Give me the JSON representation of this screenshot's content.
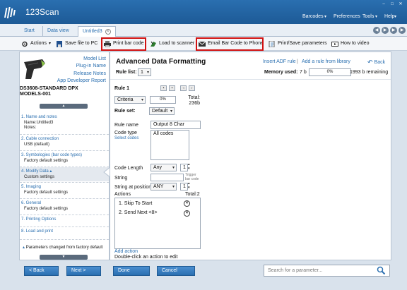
{
  "app": {
    "title": "123Scan"
  },
  "menu": [
    "Barcodes",
    "Preferences",
    "Tools",
    "Help"
  ],
  "tabs": [
    {
      "label": "Start"
    },
    {
      "label": "Data view"
    },
    {
      "label": "Untitled3"
    }
  ],
  "toolbar": {
    "actions": "Actions",
    "save_file": "Save file to PC",
    "print_barcode": "Print bar code",
    "load_scanner": "Load to scanner",
    "email_barcode": "Email Bar Code to Phone",
    "print_save": "Print/Save parameters",
    "how_to_video": "How to video"
  },
  "left": {
    "links": [
      "Model List",
      "Plug-in Name",
      "Release Notes",
      "App Developer Report"
    ],
    "model_line1": "DS3608-STANDARD DPX",
    "model_line2": "MODELS-001",
    "steps": [
      {
        "title": "1. Name and notes",
        "sub1": "Name:Untitled3",
        "sub2": "Notes:"
      },
      {
        "title": "2. Cable connection",
        "sub1": "USB (default)"
      },
      {
        "title": "3. Symbologies (bar code types)",
        "sub1": "Factory default settings"
      },
      {
        "title": "4. Modify Data",
        "sub1": "Custom settings"
      },
      {
        "title": "5. Imaging",
        "sub1": "Factory default settings"
      },
      {
        "title": "6. General",
        "sub1": "Factory default settings"
      },
      {
        "title": "7. Printing Options"
      },
      {
        "title": "8. Load and print"
      }
    ],
    "footnote": "Parameters changed from factory default"
  },
  "main": {
    "title": "Advanced Data Formatting",
    "insert_adf": "Insert ADF rule",
    "add_rule": "Add a rule from library",
    "back": "Back",
    "rule_list_label": "Rule list:",
    "rule_list_value": "1",
    "memory_label": "Memory used:",
    "memory_used": "7 b",
    "memory_percent": "0%",
    "memory_remaining": "1993 b remaining",
    "rule_title": "Rule 1",
    "criteria_label": "Criteria",
    "criteria_percent": "0%",
    "total_label": "Total:",
    "total_value": "236b",
    "rule_set_label": "Rule set:",
    "rule_set_value": "Default",
    "rule_name_label": "Rule name",
    "rule_name_value": "Output 8 Char",
    "code_type_label": "Code type",
    "select_codes": "Select codes",
    "code_type_value": "All codes",
    "code_length_label": "Code Length",
    "code_length_value": "Any",
    "code_length_num": "1",
    "string_label": "String",
    "trigger_note": "Trigger bar code",
    "string_pos_label": "String at position",
    "string_pos_value": "ANY",
    "string_pos_num": "1",
    "actions_label": "Actions",
    "actions_total": "Total:2",
    "actions": [
      "1. Skip To Start",
      "2. Send Next <8>"
    ],
    "add_action": "Add action",
    "edit_hint": "Double-click an action to edit"
  },
  "bottom": {
    "back": "< Back",
    "next": "Next >",
    "done": "Done",
    "cancel": "Cancel",
    "search_placeholder": "Search for a parameter..."
  }
}
